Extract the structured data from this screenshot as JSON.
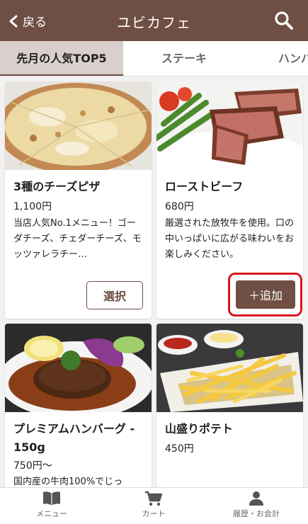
{
  "header": {
    "back_label": "戻る",
    "title": "ユビカフェ"
  },
  "tabs": [
    "先月の人気TOP5",
    "ステーキ",
    "ハンバ"
  ],
  "items": [
    {
      "name": "3種のチーズピザ",
      "price": "1,100円",
      "desc": "当店人気No.1メニュー！ゴーダチーズ、チェダーチーズ、モッツァレラチー…",
      "button": "選択"
    },
    {
      "name": "ローストビーフ",
      "price": "680円",
      "desc": "厳選された放牧牛を使用。口の中いっぱいに広がる味わいをお楽しみください。",
      "button": "＋追加"
    },
    {
      "name": "プレミアムハンバーグ - 150g",
      "price": "750円〜",
      "desc": "国内産の牛肉100%でじっ"
    },
    {
      "name": "山盛りポテト",
      "price": "450円"
    }
  ],
  "nav": {
    "menu_label": "メニュー",
    "cart_label": "カート",
    "history_label": "履歴・お会計"
  }
}
